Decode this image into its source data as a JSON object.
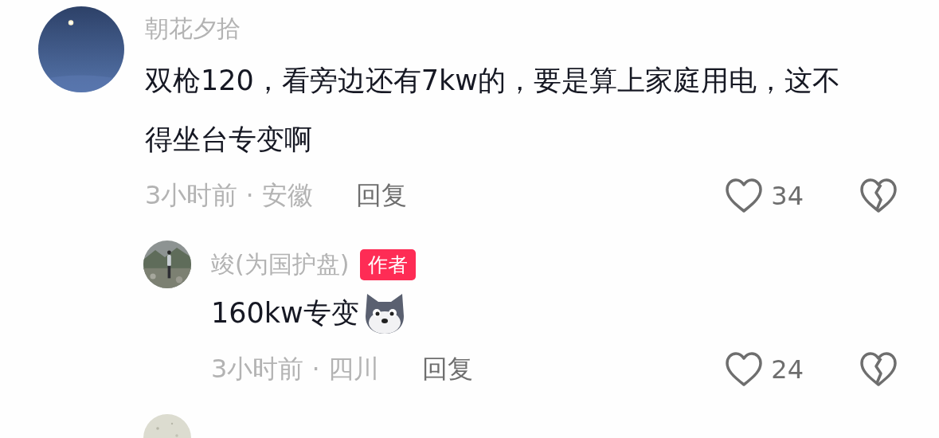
{
  "comments": [
    {
      "author": "朝花夕拾",
      "text": "双枪120，看旁边还有7kw的，要是算上家庭用电，这不得坐台专变啊",
      "meta": "3小时前 · 安徽",
      "reply_label": "回复",
      "likes": "34",
      "replies": [
        {
          "author": "竣(为国护盘)",
          "badge": "作者",
          "text": "160kw专变",
          "sticker": true,
          "meta": "3小时前 · 四川",
          "reply_label": "回复",
          "likes": "24"
        }
      ]
    }
  ]
}
